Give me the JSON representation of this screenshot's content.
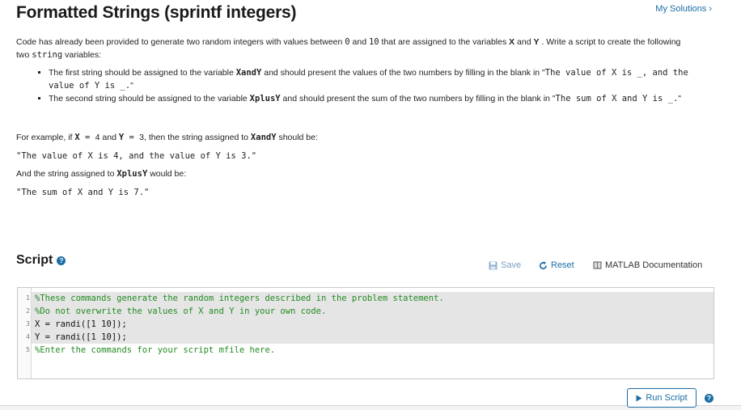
{
  "header": {
    "title": "Formatted Strings (sprintf integers)",
    "my_solutions": "My Solutions ›"
  },
  "description": {
    "part1": "Code has already been provided to generate two random integers with values between ",
    "num0": "0",
    "part2": " and ",
    "num10": "10",
    "part3": " that are assigned to the variables ",
    "varX": "X",
    "and1": " and ",
    "varY": "Y",
    "part4": " . Write a script to create the following two ",
    "string_kw": "string",
    "part5": " variables:"
  },
  "requirements": [
    {
      "pre": "The first string should be assigned to the variable ",
      "var": "XandY",
      "mid": " and should present the values of the two numbers by filling in the blank in \"",
      "code": "The value of X is _, and the value of Y is _.",
      "post": "\""
    },
    {
      "pre": "The second string should be assigned to the variable ",
      "var": "XplusY",
      "mid": " and should present the sum of the two numbers by filling in the blank in \"",
      "code": "The sum of X and Y is _.",
      "post": "\""
    }
  ],
  "example": {
    "line1_a": "For example, if ",
    "line1_X": "X",
    "line1_eq1": " = ",
    "line1_4": "4",
    "line1_and": " and ",
    "line1_Y": "Y",
    "line1_eq2": " = ",
    "line1_3": "3",
    "line1_b": ", then the string assigned to ",
    "line1_var": "XandY",
    "line1_c": " should be:",
    "string1": "\"The value of X is 4, and the value of Y is 3.\"",
    "line3_a": "And the string assigned to ",
    "line3_var": "XplusY",
    "line3_b": " would be:",
    "string2": "\"The sum of X and Y is 7.\""
  },
  "script": {
    "title": "Script",
    "save_label": "Save",
    "reset_label": "Reset",
    "docs_label": "MATLAB Documentation",
    "run_label": "Run Script",
    "lines": [
      {
        "num": "1",
        "text": "%These commands generate the random integers described in the problem statement."
      },
      {
        "num": "2",
        "text": "%Do not overwrite the values of X and Y in your own code."
      },
      {
        "num": "3",
        "text": "X = randi([1 10]);"
      },
      {
        "num": "4",
        "text": "Y = randi([1 10]);"
      },
      {
        "num": "5",
        "text": "%Enter the commands for your script mfile here."
      }
    ]
  },
  "colors": {
    "link": "#1c6ea4",
    "comment": "#228b22",
    "locked_line_bg": "#e5e5e5"
  },
  "icons": {
    "save": "floppy-disk-icon",
    "reset": "circular-arrow-icon",
    "docs": "book-icon",
    "run": "play-triangle-icon",
    "help": "question-mark-icon"
  }
}
